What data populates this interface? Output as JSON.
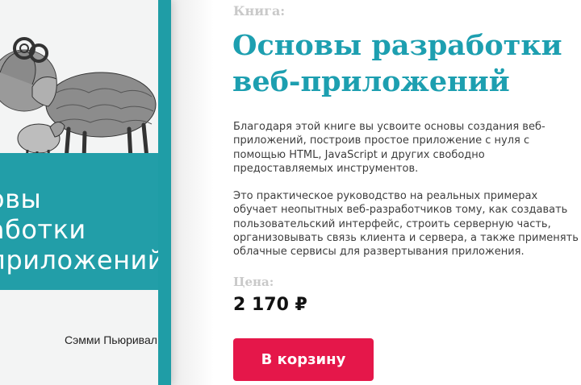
{
  "cover": {
    "title_lines": [
      "овы",
      "аботки",
      "приложений"
    ],
    "author": "Сэмми Пьюривал",
    "illustration": "sheep-engraving"
  },
  "product": {
    "kind_label": "Книга:",
    "title": "Основы разработки веб-приложений",
    "description": [
      "Благодаря этой книге вы усвоите основы создания веб-приложений, построив простое приложение с нуля с помощью HTML, JavaScript и других свободно предоставляемых инструментов.",
      "Это практическое руководство на реальных примерах обучает неопытных веб-разработчиков тому, как создавать пользовательский интерфейс, строить серверную часть, организовывать связь клиента и сервера, а также применять облачные сервисы для развертывания приложения."
    ],
    "price_label": "Цена:",
    "price": "2 170 ₽",
    "cart_button": "В корзину"
  },
  "colors": {
    "accent_teal": "#1d9fb0",
    "cover_band": "#229ea8",
    "button_red": "#e5174a",
    "muted_label": "#c9c9c9"
  }
}
